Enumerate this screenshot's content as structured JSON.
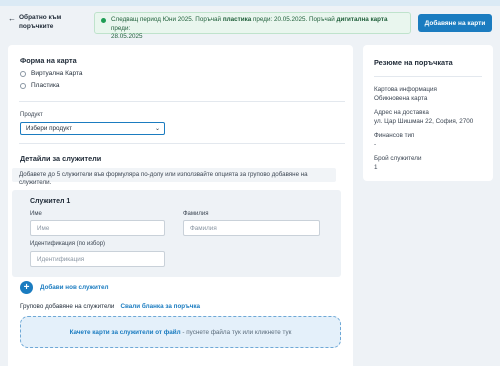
{
  "back": {
    "label_line1": "Обратно към",
    "label_line2": "поръчките"
  },
  "notice": {
    "part1": "Следващ период Юни 2025. Поръчай ",
    "plastic": "пластика",
    "part2": " преди: 20.05.2025. Поръчай ",
    "digital": "дигитална карта",
    "part3": " преди:",
    "line2": "28.05.2025"
  },
  "header": {
    "add_cards_button": "Добавяне на карти"
  },
  "form": {
    "card_form_title": "Форма на карта",
    "options": [
      "Виртуална Карта",
      "Пластика"
    ],
    "product_label": "Продукт",
    "product_value": "Избери продукт",
    "employee_details_title": "Детайли за служители",
    "info_text": "Добавете до 5 служители във формуляра по-долу или използвайте опцията за групово добавяне на служители."
  },
  "employee": {
    "title": "Служител 1",
    "first_name_label": "Име",
    "first_name_placeholder": "Име",
    "last_name_label": "Фамилия",
    "last_name_placeholder": "Фамилия",
    "id_label": "Идентификация (по избор)",
    "id_placeholder": "Идентификация"
  },
  "actions": {
    "add_employee": "Добави нов служител",
    "bulk_label": "Групово добавяне на служители",
    "download_template": "Свали бланка за поръчка"
  },
  "dropzone": {
    "strong": "Качете карти за служители от файл",
    "rest": " - пуснете файла тук или кликнете тук"
  },
  "summary": {
    "title": "Резюме на поръчката",
    "card_info_label": "Картова информация",
    "card_info_value": "Обикновена карта",
    "address_label": "Адрес на доставка",
    "address_value": "ул. Цар Шишман 22, София, 2700",
    "fin_type_label": "Финансов тип",
    "fin_type_value": "-",
    "employee_count_label": "Брой служители",
    "employee_count_value": "1"
  },
  "colors": {
    "accent": "#1b7cc0",
    "notice_bg": "#e9f6ee",
    "notice_dot": "#1f9d55"
  }
}
